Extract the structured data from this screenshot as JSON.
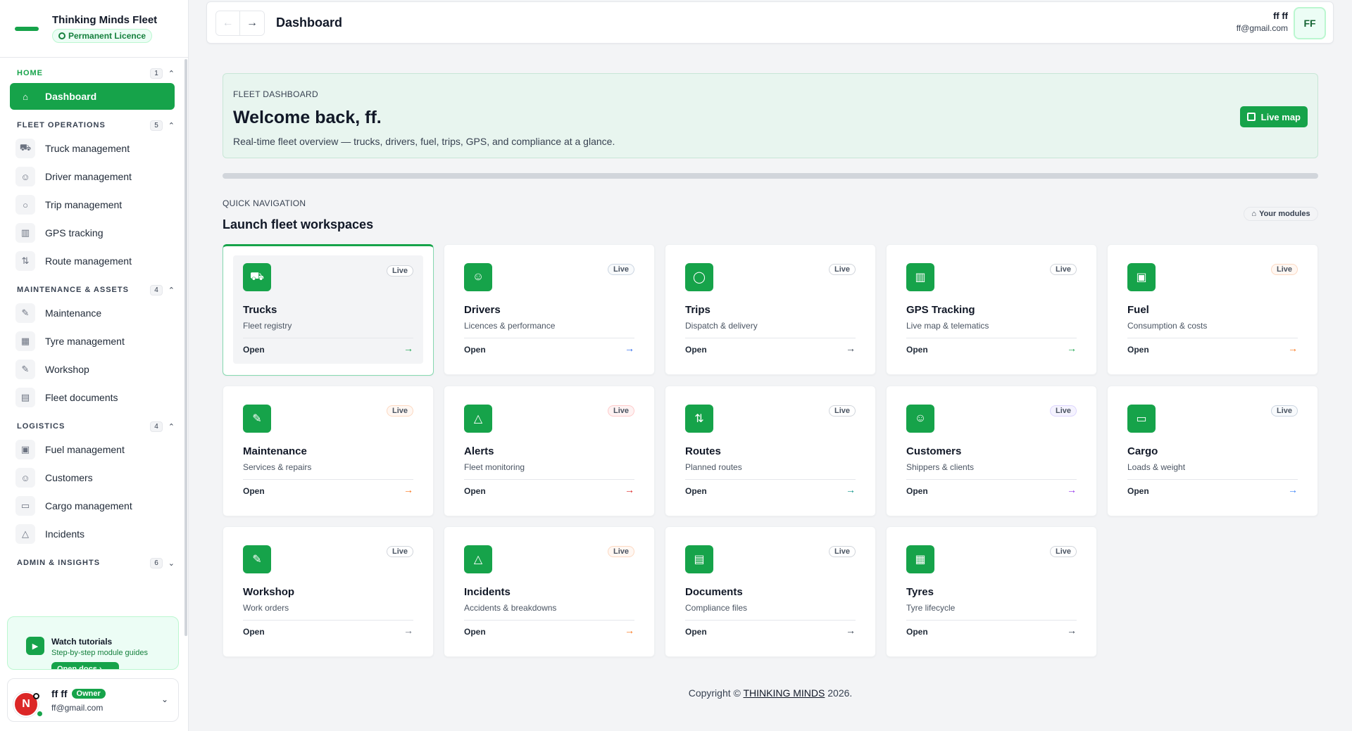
{
  "brand": {
    "title": "Thinking Minds Fleet",
    "licence": "Permanent Licence"
  },
  "sidebar": {
    "sections": [
      {
        "title": "HOME",
        "count": "1",
        "chevron": "⌃",
        "items": [
          {
            "label": "Dashboard",
            "icon": "⌂"
          }
        ]
      },
      {
        "title": "FLEET OPERATIONS",
        "count": "5",
        "chevron": "⌃",
        "items": [
          {
            "label": "Truck management",
            "icon": "⛟"
          },
          {
            "label": "Driver management",
            "icon": "☺"
          },
          {
            "label": "Trip management",
            "icon": "○"
          },
          {
            "label": "GPS tracking",
            "icon": "▥"
          },
          {
            "label": "Route management",
            "icon": "⇅"
          }
        ]
      },
      {
        "title": "MAINTENANCE & ASSETS",
        "count": "4",
        "chevron": "⌃",
        "items": [
          {
            "label": "Maintenance",
            "icon": "✎"
          },
          {
            "label": "Tyre management",
            "icon": "▦"
          },
          {
            "label": "Workshop",
            "icon": "✎"
          },
          {
            "label": "Fleet documents",
            "icon": "▤"
          }
        ]
      },
      {
        "title": "LOGISTICS",
        "count": "4",
        "chevron": "⌃",
        "items": [
          {
            "label": "Fuel management",
            "icon": "▣"
          },
          {
            "label": "Customers",
            "icon": "☺"
          },
          {
            "label": "Cargo management",
            "icon": "▭"
          },
          {
            "label": "Incidents",
            "icon": "△"
          }
        ]
      },
      {
        "title": "ADMIN & INSIGHTS",
        "count": "6",
        "chevron": "⌄",
        "items": []
      }
    ],
    "tutorial": {
      "title": "Watch tutorials",
      "subtitle": "Step-by-step module guides",
      "button": "Open docs ›"
    },
    "user": {
      "initial": "N",
      "name": "ff ff",
      "role": "Owner",
      "email": "ff@gmail.com"
    }
  },
  "topbar": {
    "back": "←",
    "forward": "→",
    "title": "Dashboard",
    "user_name": "ff ff",
    "user_email": "ff@gmail.com",
    "avatar": "FF"
  },
  "welcome": {
    "eyebrow": "FLEET DASHBOARD",
    "title": "Welcome back, ff.",
    "subtitle": "Real-time fleet overview — trucks, drivers, fuel, trips, GPS, and compliance at a glance.",
    "live_map": "Live map"
  },
  "quick_nav": {
    "eyebrow": "QUICK NAVIGATION",
    "title": "Launch fleet workspaces",
    "modules": "Your modules"
  },
  "cards": [
    {
      "title": "Trucks",
      "subtitle": "Fleet registry",
      "badge": "Live",
      "open": "Open",
      "icon": "⛟",
      "badge_tone": "",
      "arrow_color": "#16a34a"
    },
    {
      "title": "Drivers",
      "subtitle": "Licences & performance",
      "badge": "Live",
      "open": "Open",
      "icon": "☺",
      "badge_tone": "blue",
      "arrow_color": "#2563eb"
    },
    {
      "title": "Trips",
      "subtitle": "Dispatch & delivery",
      "badge": "Live",
      "open": "Open",
      "icon": "◯",
      "badge_tone": "",
      "arrow_color": "#374151"
    },
    {
      "title": "GPS Tracking",
      "subtitle": "Live map & telematics",
      "badge": "Live",
      "open": "Open",
      "icon": "▥",
      "badge_tone": "",
      "arrow_color": "#16a34a"
    },
    {
      "title": "Fuel",
      "subtitle": "Consumption & costs",
      "badge": "Live",
      "open": "Open",
      "icon": "▣",
      "badge_tone": "warn",
      "arrow_color": "#f97316"
    },
    {
      "title": "Maintenance",
      "subtitle": "Services & repairs",
      "badge": "Live",
      "open": "Open",
      "icon": "✎",
      "badge_tone": "warn",
      "arrow_color": "#f97316"
    },
    {
      "title": "Alerts",
      "subtitle": "Fleet monitoring",
      "badge": "Live",
      "open": "Open",
      "icon": "△",
      "badge_tone": "red",
      "arrow_color": "#dc2626"
    },
    {
      "title": "Routes",
      "subtitle": "Planned routes",
      "badge": "Live",
      "open": "Open",
      "icon": "⇅",
      "badge_tone": "",
      "arrow_color": "#0d9488"
    },
    {
      "title": "Customers",
      "subtitle": "Shippers & clients",
      "badge": "Live",
      "open": "Open",
      "icon": "☺",
      "badge_tone": "purple",
      "arrow_color": "#9333ea"
    },
    {
      "title": "Cargo",
      "subtitle": "Loads & weight",
      "badge": "Live",
      "open": "Open",
      "icon": "▭",
      "badge_tone": "blue",
      "arrow_color": "#3b82f6"
    },
    {
      "title": "Workshop",
      "subtitle": "Work orders",
      "badge": "Live",
      "open": "Open",
      "icon": "✎",
      "badge_tone": "",
      "arrow_color": "#6b7280"
    },
    {
      "title": "Incidents",
      "subtitle": "Accidents & breakdowns",
      "badge": "Live",
      "open": "Open",
      "icon": "△",
      "badge_tone": "warn",
      "arrow_color": "#f97316"
    },
    {
      "title": "Documents",
      "subtitle": "Compliance files",
      "badge": "Live",
      "open": "Open",
      "icon": "▤",
      "badge_tone": "",
      "arrow_color": "#374151"
    },
    {
      "title": "Tyres",
      "subtitle": "Tyre lifecycle",
      "badge": "Live",
      "open": "Open",
      "icon": "▦",
      "badge_tone": "",
      "arrow_color": "#374151"
    }
  ],
  "footer": {
    "prefix": "Copyright © ",
    "company": "THINKING MINDS",
    "suffix": " 2026."
  }
}
